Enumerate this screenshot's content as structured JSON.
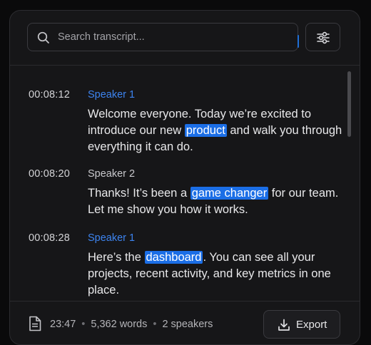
{
  "search": {
    "placeholder": "Search transcript...",
    "value": ""
  },
  "filter_button": {
    "icon": "sliders-icon"
  },
  "transcript": {
    "entries": [
      {
        "time": "00:08:12",
        "speaker": "Speaker 1",
        "speaker_color": "#3d84f0",
        "text_before": "Welcome everyone. Today we’re excited to introduce our new ",
        "highlight": "product",
        "text_after": " and walk you through everything it can do."
      },
      {
        "time": "00:08:20",
        "speaker": "Speaker 2",
        "speaker_color": "#c8c8cc",
        "text_before": "Thanks! It’s been a ",
        "highlight": "game changer",
        "text_after": " for our team. Let me show you how it works."
      },
      {
        "time": "00:08:28",
        "speaker": "Speaker 1",
        "speaker_color": "#3d84f0",
        "text_before": "Here’s the ",
        "highlight": "dashboard",
        "text_after": ". You can see all your projects, recent activity, and key metrics in one place."
      }
    ]
  },
  "footer": {
    "icon": "file-icon",
    "duration": "23:47",
    "words": "5,362 words",
    "speakers": "2 speakers",
    "separator": "•",
    "export_label": "Export",
    "export_icon": "download-icon"
  },
  "colors": {
    "background": "#161618",
    "accent": "#1b6ee6",
    "speaker_blue": "#3d84f0"
  }
}
